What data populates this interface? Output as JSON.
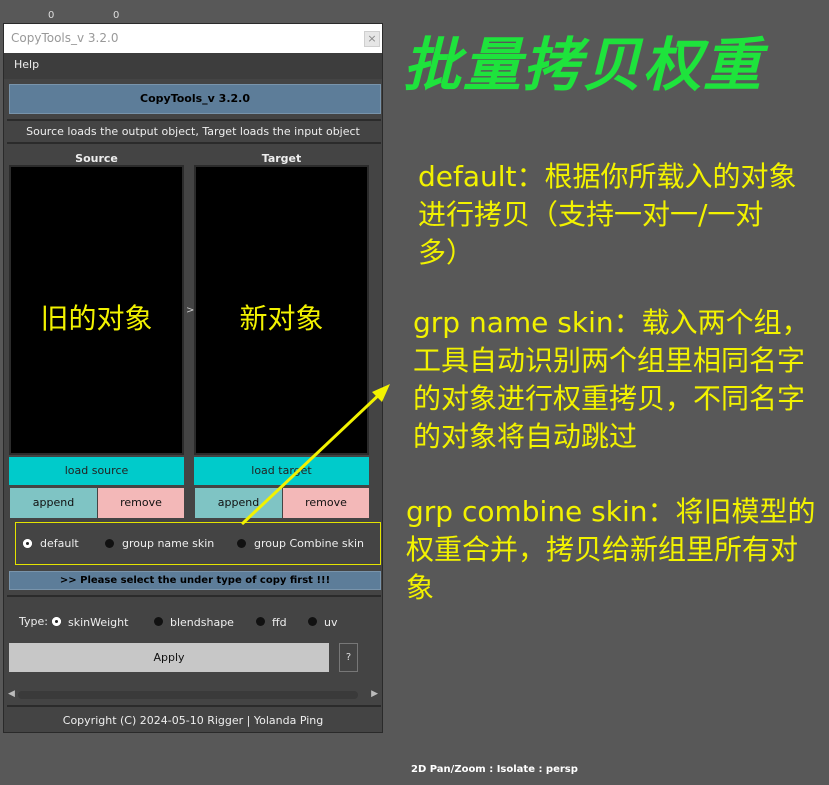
{
  "counters": [
    "0",
    "0"
  ],
  "window": {
    "title": "CopyTools_v 3.2.0",
    "close": "×"
  },
  "menu": {
    "help": "Help"
  },
  "banner": "CopyTools_v 3.2.0",
  "instruction": "Source loads the output object, Target loads the input object",
  "source": {
    "label": "Source",
    "text": "旧的对象",
    "load": "load source",
    "append": "append",
    "remove": "remove"
  },
  "target": {
    "label": "Target",
    "text": "新对象",
    "load": "load target",
    "append": "append",
    "remove": "remove"
  },
  "mid_arrow": ">",
  "modes": {
    "options": [
      "default",
      "group name skin",
      "group Combine skin"
    ],
    "selected": "default"
  },
  "warning": ">> Please select the under type of copy first !!!",
  "type": {
    "label": "Type:",
    "options": [
      "skinWeight",
      "blendshape",
      "ffd",
      "uv"
    ],
    "selected": "skinWeight"
  },
  "apply": "Apply",
  "help_btn": "?",
  "footer": "Copyright (C)  2024-05-10  Rigger  | Yolanda Ping",
  "overlay": {
    "title": "批量拷贝权重",
    "note_default": [
      "default：根据你所载入的对象",
      "进行拷贝（支持一对一/一对",
      "多）"
    ],
    "note_grp_name": [
      "grp name skin：载入两个组，",
      "工具自动识别两个组里相同名字",
      "的对象进行权重拷贝，不同名字",
      "的对象将自动跳过"
    ],
    "note_grp_combine": [
      "grp combine skin：将旧模型的",
      "权重合并，拷贝给新组里所有对",
      "象"
    ]
  },
  "status": "2D Pan/Zoom : Isolate : persp",
  "colors": {
    "title_green": "#1ee33c",
    "note_yellow": "#f2f200",
    "load_cyan": "#00cbcb",
    "remove_pink": "#f3b8b8"
  }
}
